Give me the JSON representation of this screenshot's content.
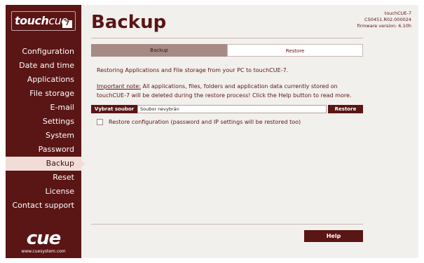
{
  "sidebar": {
    "logo": {
      "brand_bold": "touch",
      "brand_light": "cue",
      "version_badge": "7"
    },
    "items": [
      {
        "label": "Configuration",
        "active": false
      },
      {
        "label": "Date and time",
        "active": false
      },
      {
        "label": "Applications",
        "active": false
      },
      {
        "label": "File storage",
        "active": false
      },
      {
        "label": "E-mail",
        "active": false
      },
      {
        "label": "Settings",
        "active": false
      },
      {
        "label": "System",
        "active": false
      },
      {
        "label": "Password",
        "active": false
      },
      {
        "label": "Backup",
        "active": true
      },
      {
        "label": "Reset",
        "active": false
      },
      {
        "label": "License",
        "active": false
      },
      {
        "label": "Contact support",
        "active": false
      }
    ],
    "bottom_logo": {
      "text": "cue",
      "url": "www.cuesystem.com"
    }
  },
  "header": {
    "title": "Backup",
    "device": {
      "name": "touchCUE-7",
      "serial": "CS0451.R02.000024",
      "firmware": "firmware version: 6.10h"
    }
  },
  "tabs": [
    {
      "label": "Backup",
      "active": true
    },
    {
      "label": "Restore",
      "active": false
    }
  ],
  "content": {
    "intro": "Restoring Applications and File storage from your PC to touchCUE-7.",
    "note_label": "Important note:",
    "note_text": " All applications, files, folders and application data currently stored on touchCUE-7 will be deleted during the restore process! Click the Help button to read more.",
    "file_button": "Vybrat soubor",
    "file_value": "Soubor nevybrán",
    "restore_button": "Restore",
    "restore_config_label": "Restore configuration (password and IP settings will be restored too)",
    "restore_config_checked": false
  },
  "footer": {
    "help_button": "Help"
  },
  "colors": {
    "brand": "#5a1515",
    "background": "#f2f0ec",
    "active_nav": "#f2dcd8",
    "active_tab": "#a58a85"
  }
}
